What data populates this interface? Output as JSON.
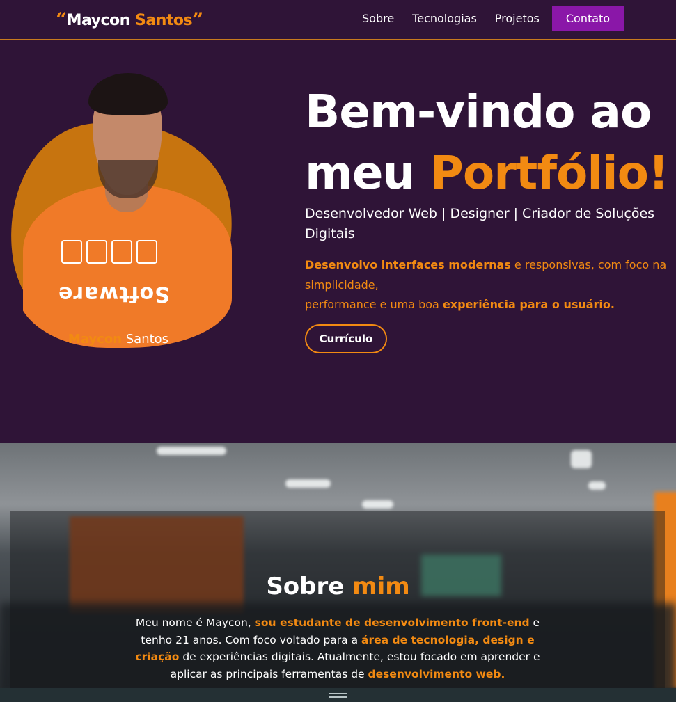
{
  "header": {
    "logo_open_quote": "“",
    "logo_first": "Maycon",
    "logo_last": "Santos",
    "logo_close_quote": "”",
    "nav": {
      "sobre": "Sobre",
      "tecnologias": "Tecnologias",
      "projetos": "Projetos",
      "contato": "Contato"
    }
  },
  "hero": {
    "photo_caption_first": "Maycon",
    "photo_caption_last": "Santos",
    "shirt_text": "Software",
    "title_line1": "Bem-vindo ao",
    "title_line2_plain": "meu ",
    "title_line2_accent": "Portfólio!",
    "subtitle": "Desenvolvedor Web | Designer | Criador de Soluções Digitais",
    "desc_bold1": "Desenvolvo interfaces modernas",
    "desc_text1": " e responsivas, com foco na simplicidade,",
    "desc_text2": "performance e uma boa ",
    "desc_bold2": "experiência para o usuário.",
    "cv_button": "Currículo"
  },
  "about": {
    "title_plain": "Sobre ",
    "title_accent": "mim",
    "p_text1": "Meu nome é Maycon, ",
    "p_bold1": "sou estudante de desenvolvimento front-end",
    "p_text2": " e tenho 21 anos. Com foco voltado para a ",
    "p_bold2": "área de tecnologia, design e criação",
    "p_text3": " de experiências digitais. Atualmente, estou focado em aprender e aplicar as principais ferramentas de ",
    "p_bold3": "desenvolvimento web."
  },
  "colors": {
    "background": "#2f1437",
    "accent": "#f28a12",
    "contact_button": "#8a17a8"
  }
}
